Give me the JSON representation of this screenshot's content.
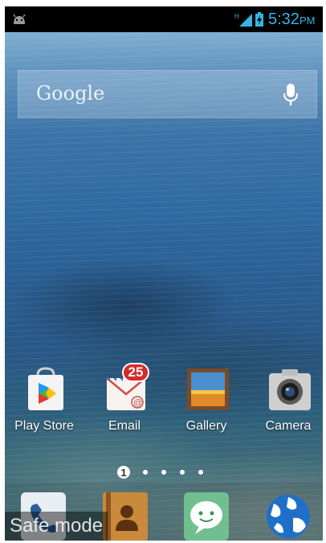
{
  "status_bar": {
    "time": "5:32",
    "ampm": "PM",
    "notification_icon": "android-icon",
    "signal_icon": "signal-hspa-icon",
    "battery_icon": "battery-charging-icon",
    "accent_color": "#33b5e5"
  },
  "search": {
    "brand_label": "Google",
    "voice_icon": "mic-icon"
  },
  "apps": [
    {
      "label": "Play Store",
      "icon": "play-store-icon"
    },
    {
      "label": "Email",
      "icon": "email-icon",
      "badge": "25"
    },
    {
      "label": "Gallery",
      "icon": "gallery-icon"
    },
    {
      "label": "Camera",
      "icon": "camera-icon"
    }
  ],
  "pager": {
    "current_page": "1",
    "total_pages": 5
  },
  "dock": [
    {
      "icon": "phone-icon"
    },
    {
      "icon": "contacts-icon"
    },
    {
      "icon": "messaging-icon"
    },
    {
      "icon": "browser-icon"
    }
  ],
  "overlay": {
    "safe_mode_label": "Safe mode"
  }
}
